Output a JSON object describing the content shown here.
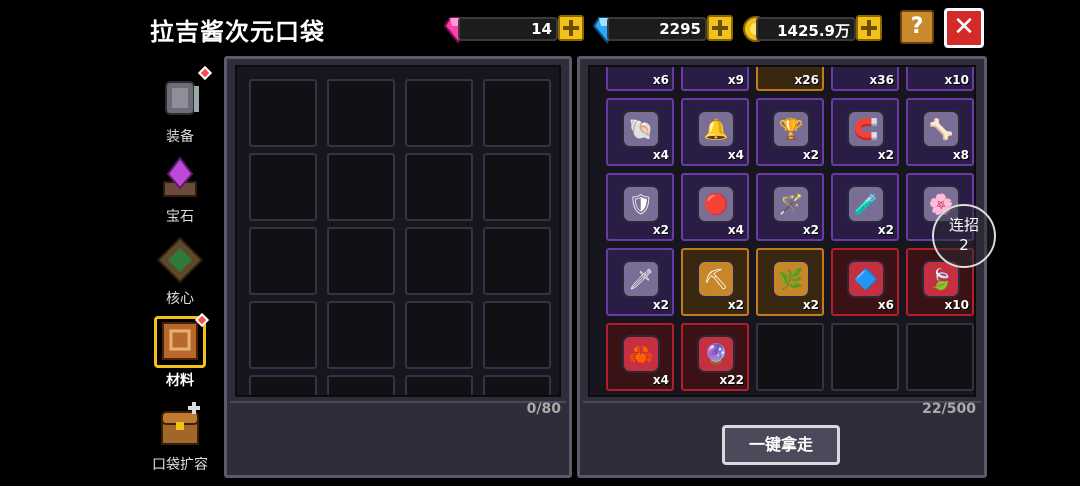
{
  "title": "拉吉酱次元口袋",
  "currency": {
    "pink_gem": "14",
    "diamond": "2295",
    "gold": "1425.9万"
  },
  "buttons": {
    "help": "?",
    "close": "✕"
  },
  "sidebar": [
    {
      "label": "装备",
      "icon": "armor-icon",
      "dot": true
    },
    {
      "label": "宝石",
      "icon": "gem-icon",
      "dot": false
    },
    {
      "label": "核心",
      "icon": "core-icon",
      "dot": false
    },
    {
      "label": "材料",
      "icon": "material-book-icon",
      "dot": true,
      "selected": true
    },
    {
      "label": "口袋扩容",
      "icon": "chest-icon",
      "dot": false
    }
  ],
  "left_panel": {
    "count": "0/80"
  },
  "right_panel": {
    "count": "22/500",
    "top_row_qty": [
      "x6",
      "x9",
      "x26",
      "x36",
      "x10"
    ],
    "items": [
      {
        "icon": "shell-icon",
        "glyph": "🐚",
        "qty": "x4",
        "rarity": "purple"
      },
      {
        "icon": "bell-icon",
        "glyph": "🔔",
        "qty": "x4",
        "rarity": "purple"
      },
      {
        "icon": "trophy-icon",
        "glyph": "🏆",
        "qty": "x2",
        "rarity": "purple"
      },
      {
        "icon": "horseshoe-icon",
        "glyph": "🧲",
        "qty": "x2",
        "rarity": "purple"
      },
      {
        "icon": "horn-icon",
        "glyph": "🦴",
        "qty": "x8",
        "rarity": "purple"
      },
      {
        "icon": "shield-card-icon",
        "glyph": "🛡",
        "qty": "x2",
        "rarity": "purple"
      },
      {
        "icon": "red-orb-icon",
        "glyph": "🔴",
        "qty": "x4",
        "rarity": "purple"
      },
      {
        "icon": "wand-icon",
        "glyph": "🪄",
        "qty": "x2",
        "rarity": "purple"
      },
      {
        "icon": "potion-icon",
        "glyph": "🧪",
        "qty": "x2",
        "rarity": "purple"
      },
      {
        "icon": "flower-icon",
        "glyph": "🌸",
        "qty": "",
        "rarity": "purple"
      },
      {
        "icon": "rod-icon",
        "glyph": "🗡",
        "qty": "x2",
        "rarity": "purple"
      },
      {
        "icon": "pickaxe-icon",
        "glyph": "⛏",
        "qty": "x2",
        "rarity": "orange"
      },
      {
        "icon": "herb-icon",
        "glyph": "🌿",
        "qty": "x2",
        "rarity": "orange"
      },
      {
        "icon": "crystal-icon",
        "glyph": "🔷",
        "qty": "x6",
        "rarity": "red"
      },
      {
        "icon": "leaf-icon",
        "glyph": "🍃",
        "qty": "x10",
        "rarity": "red"
      },
      {
        "icon": "claw-icon",
        "glyph": "🦀",
        "qty": "x4",
        "rarity": "red"
      },
      {
        "icon": "magic-orb-icon",
        "glyph": "🔮",
        "qty": "x22",
        "rarity": "red"
      }
    ],
    "take_all": "一键拿走"
  },
  "tooltip": {
    "line1": "连招",
    "line2": "2"
  },
  "colors": {
    "pink_gem": "#ff3fae",
    "diamond": "#2aa9ff",
    "gold": "#f2c21a",
    "close": "#d32a2a"
  }
}
